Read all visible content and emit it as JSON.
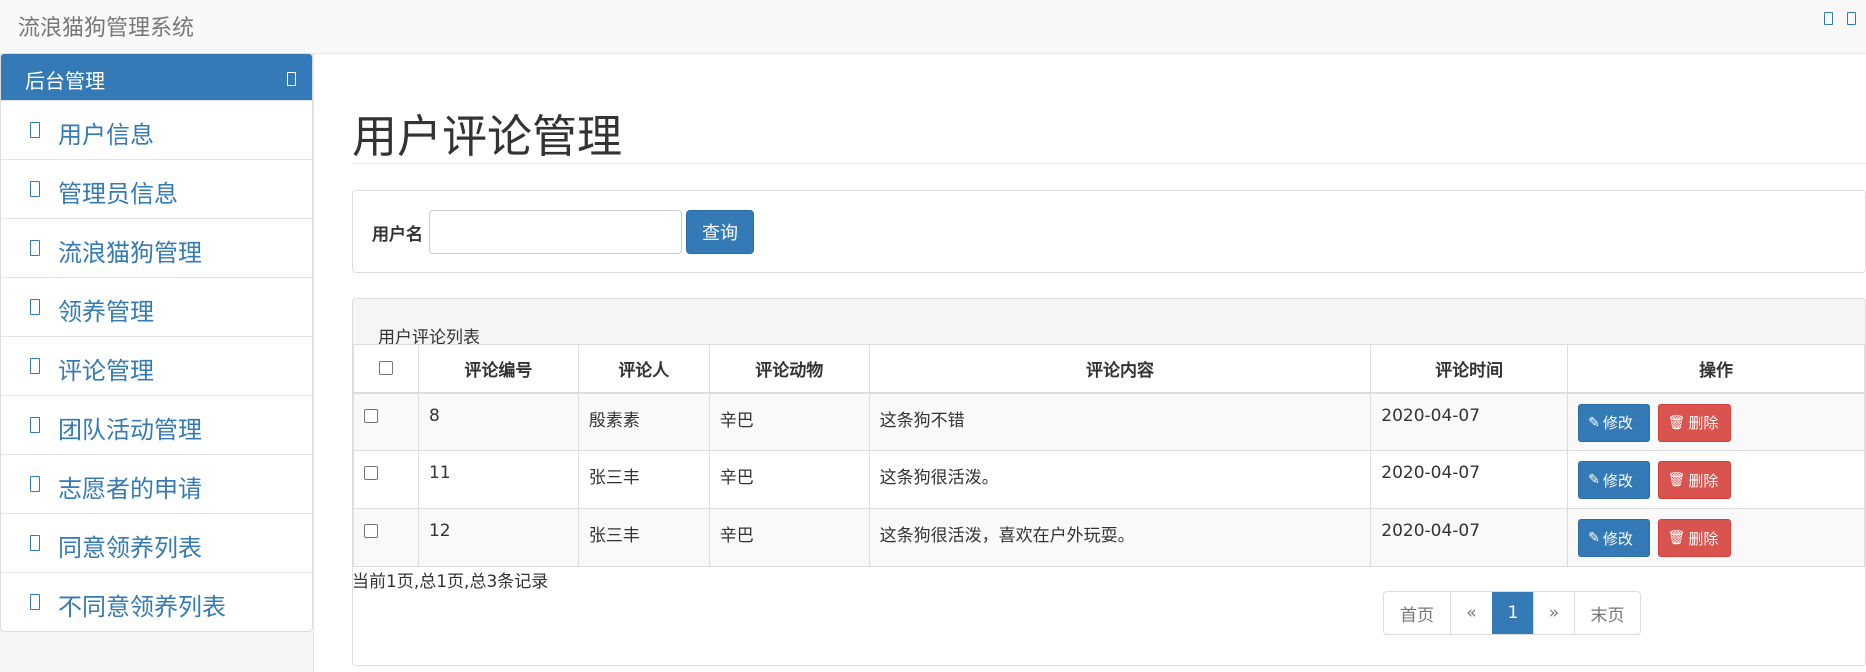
{
  "navbar": {
    "brand": "流浪猫狗管理系统"
  },
  "sidebar": {
    "heading": "后台管理",
    "items": [
      {
        "label": "用户信息"
      },
      {
        "label": "管理员信息"
      },
      {
        "label": "流浪猫狗管理"
      },
      {
        "label": "领养管理"
      },
      {
        "label": "评论管理"
      },
      {
        "label": "团队活动管理"
      },
      {
        "label": "志愿者的申请"
      },
      {
        "label": "同意领养列表"
      },
      {
        "label": "不同意领养列表"
      }
    ]
  },
  "main": {
    "title": "用户评论管理",
    "search": {
      "label": "用户名",
      "value": "",
      "placeholder": "",
      "button": "查询"
    },
    "list": {
      "heading": "用户评论列表",
      "columns": [
        "评论编号",
        "评论人",
        "评论动物",
        "评论内容",
        "评论时间",
        "操作"
      ],
      "rows": [
        {
          "id": "8",
          "user": "殷素素",
          "animal": "辛巴",
          "content": "这条狗不错",
          "time": "2020-04-07"
        },
        {
          "id": "11",
          "user": "张三丰",
          "animal": "辛巴",
          "content": "这条狗很活泼。",
          "time": "2020-04-07"
        },
        {
          "id": "12",
          "user": "张三丰",
          "animal": "辛巴",
          "content": "这条狗很活泼，喜欢在户外玩耍。",
          "time": "2020-04-07"
        }
      ],
      "edit_label": "修改",
      "delete_label": "删除"
    },
    "record_info": "当前1页,总1页,总3条记录",
    "pager": {
      "first": "首页",
      "prev": "«",
      "current": "1",
      "next": "»",
      "last": "末页"
    }
  },
  "colors": {
    "primary": "#337ab7",
    "danger": "#d9534f"
  }
}
